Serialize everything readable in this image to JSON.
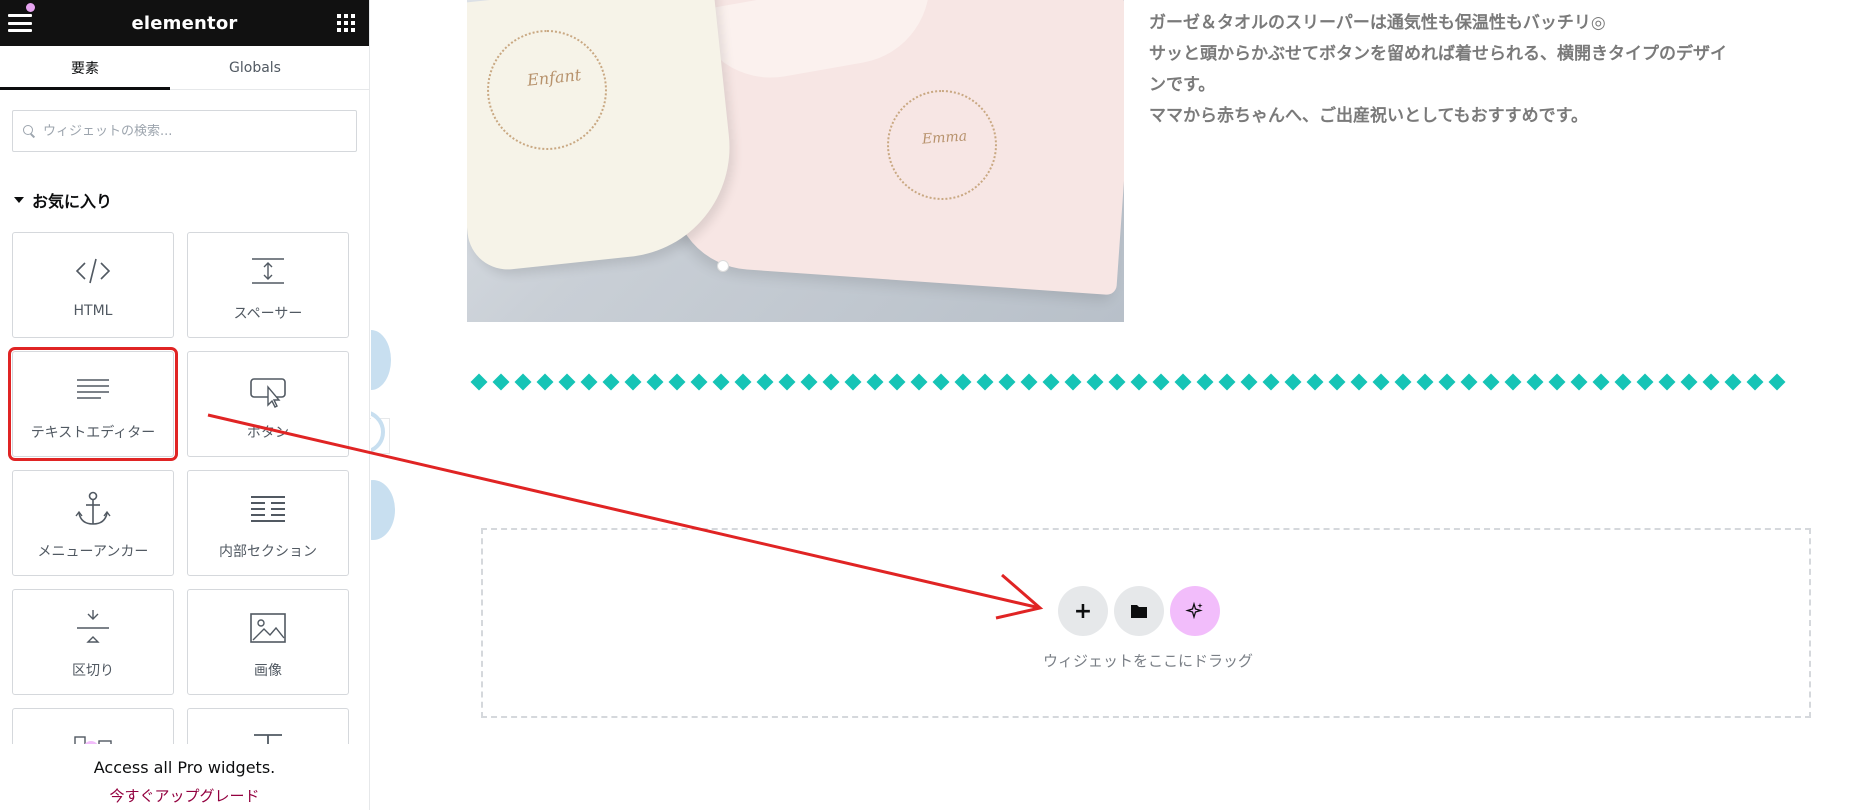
{
  "panel": {
    "logo": "elementor",
    "tabs": [
      {
        "label": "要素"
      },
      {
        "label": "Globals"
      }
    ],
    "search": {
      "placeholder": "ウィジェットの検索..."
    },
    "category": {
      "label": "お気に入り"
    },
    "widgets": [
      {
        "label": "HTML",
        "icon": "code-icon"
      },
      {
        "label": "スペーサー",
        "icon": "spacer-icon"
      },
      {
        "label": "テキストエディター",
        "icon": "text-editor-icon"
      },
      {
        "label": "ボタン",
        "icon": "button-icon"
      },
      {
        "label": "メニューアンカー",
        "icon": "anchor-icon"
      },
      {
        "label": "内部セクション",
        "icon": "inner-section-icon"
      },
      {
        "label": "区切り",
        "icon": "divider-icon"
      },
      {
        "label": "画像",
        "icon": "image-icon"
      },
      {
        "label": "",
        "icon": "pro-widget-icon"
      },
      {
        "label": "",
        "icon": "heading-icon"
      }
    ],
    "pro_banner": {
      "text": "Access all Pro widgets.",
      "link": "今すぐアップグレード"
    }
  },
  "preview": {
    "description": [
      "ガーゼ＆タオルのスリーパーは通気性も保温性もバッチリ◎",
      "サッと頭からかぶせてボタンを留めれば着せられる、横開きタイプのデザイ",
      "ンです。",
      "ママから赤ちゃんへ、ご出産祝いとしてもおすすめです。"
    ],
    "photo_names": [
      "Enfant",
      "Emma"
    ],
    "dropzone": {
      "text": "ウィジェットをここにドラッグ",
      "buttons": [
        "+",
        "",
        ""
      ]
    }
  },
  "colors": {
    "topbar": "#111111",
    "highlight": "#e02424",
    "divider_diamond": "#16c4b6",
    "ai_button": "#f2bdfb",
    "upgrade_link": "#93003f"
  }
}
